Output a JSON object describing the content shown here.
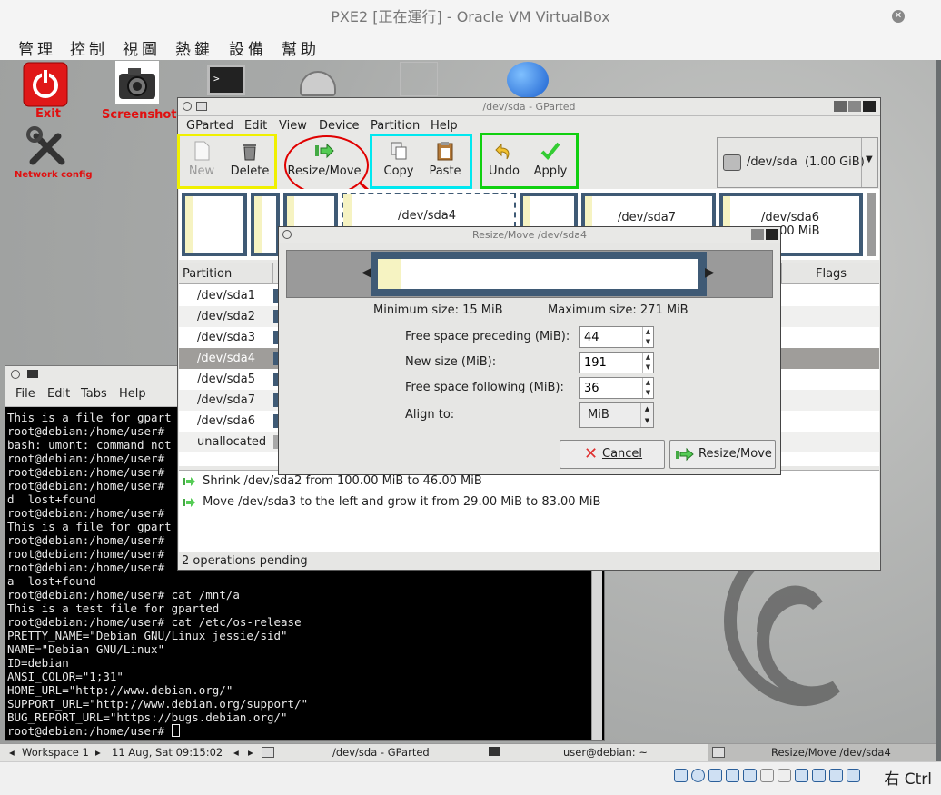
{
  "vbox": {
    "title": "PXE2 [正在運行] - Oracle VM VirtualBox",
    "menu": [
      "管理",
      "控制",
      "視圖",
      "熱鍵",
      "設備",
      "幫助"
    ],
    "host_key": "右 Ctrl"
  },
  "desktop": {
    "icons": {
      "exit": "Exit",
      "screenshot": "Screenshot",
      "network": "Network config"
    }
  },
  "gparted": {
    "title": "/dev/sda - GParted",
    "menu": [
      "GParted",
      "Edit",
      "View",
      "Device",
      "Partition",
      "Help"
    ],
    "toolbar": {
      "new": "New",
      "delete": "Delete",
      "resize_move": "Resize/Move",
      "copy": "Copy",
      "paste": "Paste",
      "undo": "Undo",
      "apply": "Apply"
    },
    "device_selector": "/dev/sda  (1.00 GiB)",
    "map_labels": {
      "sda4": "/dev/sda4",
      "sda7": "/dev/sda7",
      "sda6": "/dev/sda6",
      "sda6_size": ".00 MiB"
    },
    "columns": {
      "partition": "Partition",
      "flags": "Flags"
    },
    "partitions": [
      "/dev/sda1",
      "/dev/sda2",
      "/dev/sda3",
      "/dev/sda4",
      "/dev/sda5",
      "/dev/sda7",
      "/dev/sda6",
      "unallocated"
    ],
    "operations": [
      "Shrink /dev/sda2 from 100.00 MiB to 46.00 MiB",
      "Move /dev/sda3 to the left and grow it from 29.00 MiB to 83.00 MiB"
    ],
    "status": "2 operations pending"
  },
  "dialog": {
    "title": "Resize/Move /dev/sda4",
    "min_size": "Minimum size: 15 MiB",
    "max_size": "Maximum size: 271 MiB",
    "labels": {
      "preceding": "Free space preceding (MiB):",
      "new_size": "New size (MiB):",
      "following": "Free space following (MiB):",
      "align": "Align to:"
    },
    "values": {
      "preceding": "44",
      "new_size": "191",
      "following": "36",
      "align": "MiB"
    },
    "cancel": "Cancel",
    "resize_move": "Resize/Move"
  },
  "terminal": {
    "menu": [
      "File",
      "Edit",
      "Tabs",
      "Help"
    ],
    "lines": [
      "This is a file for gpart",
      "root@debian:/home/user#",
      "bash: umont: command not",
      "root@debian:/home/user#",
      "root@debian:/home/user#",
      "root@debian:/home/user#",
      "d  lost+found",
      "root@debian:/home/user#",
      "This is a file for gpart",
      "root@debian:/home/user#",
      "root@debian:/home/user#",
      "root@debian:/home/user#",
      "a  lost+found",
      "root@debian:/home/user# cat /mnt/a",
      "This is a test file for gparted",
      "root@debian:/home/user# cat /etc/os-release",
      "PRETTY_NAME=\"Debian GNU/Linux jessie/sid\"",
      "NAME=\"Debian GNU/Linux\"",
      "ID=debian",
      "ANSI_COLOR=\"1;31\"",
      "HOME_URL=\"http://www.debian.org/\"",
      "SUPPORT_URL=\"http://www.debian.org/support/\"",
      "BUG_REPORT_URL=\"https://bugs.debian.org/\"",
      "root@debian:/home/user# "
    ]
  },
  "taskbar": {
    "workspace": "Workspace 1",
    "clock": "11 Aug, Sat 09:15:02",
    "tasks": [
      "/dev/sda - GParted",
      "user@debian: ~",
      "Resize/Move /dev/sda4"
    ]
  },
  "colors": {
    "highlight_yellow": "#f0f000",
    "highlight_red": "#e00000",
    "highlight_cyan": "#00e8f0",
    "highlight_green": "#10d010",
    "partition_border": "#3f5a75",
    "selected_row": "#9f9d9a"
  }
}
